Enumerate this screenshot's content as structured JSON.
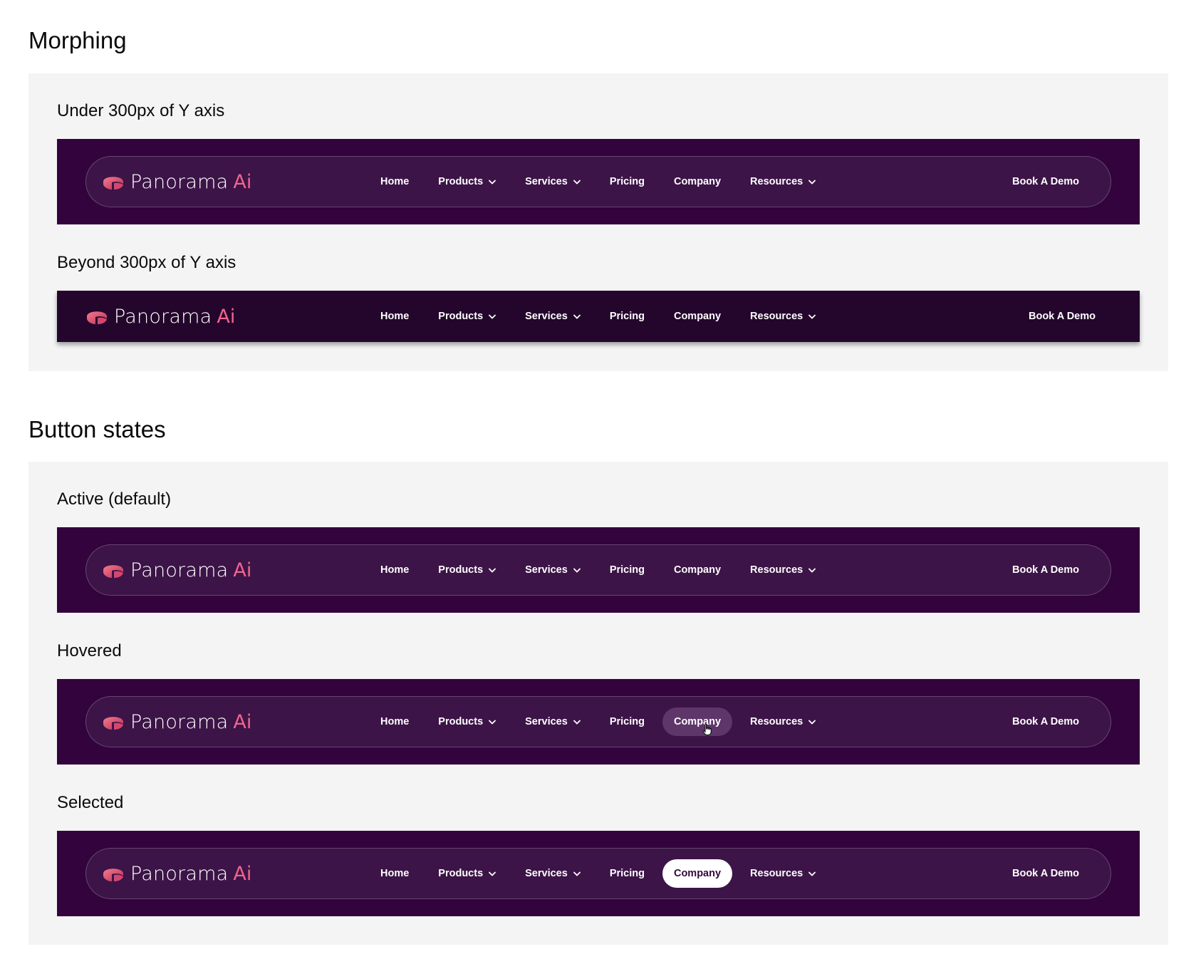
{
  "sections": {
    "morphing": {
      "title": "Morphing",
      "under_label": "Under 300px of Y axis",
      "beyond_label": "Beyond 300px of Y axis"
    },
    "button_states": {
      "title": "Button states",
      "active_label": "Active (default)",
      "hovered_label": "Hovered",
      "selected_label": "Selected"
    }
  },
  "navbar": {
    "brand_name": "Panorama",
    "brand_suffix": "Ai",
    "links": {
      "home": "Home",
      "products": "Products",
      "services": "Services",
      "pricing": "Pricing",
      "company": "Company",
      "resources": "Resources"
    },
    "cta": "Book A Demo"
  },
  "colors": {
    "stage_background": "#33033d",
    "pill_background": "#3c1447",
    "scrolled_background": "#24062c",
    "hover_background": "#5e3669",
    "selected_background": "#ffffff",
    "brand_accent": "#f0648c",
    "panel_background": "#f4f4f4"
  },
  "icons": {
    "logo": "panorama-logo-icon",
    "dropdown": "chevron-down-icon",
    "cursor": "hand-pointer-icon"
  }
}
